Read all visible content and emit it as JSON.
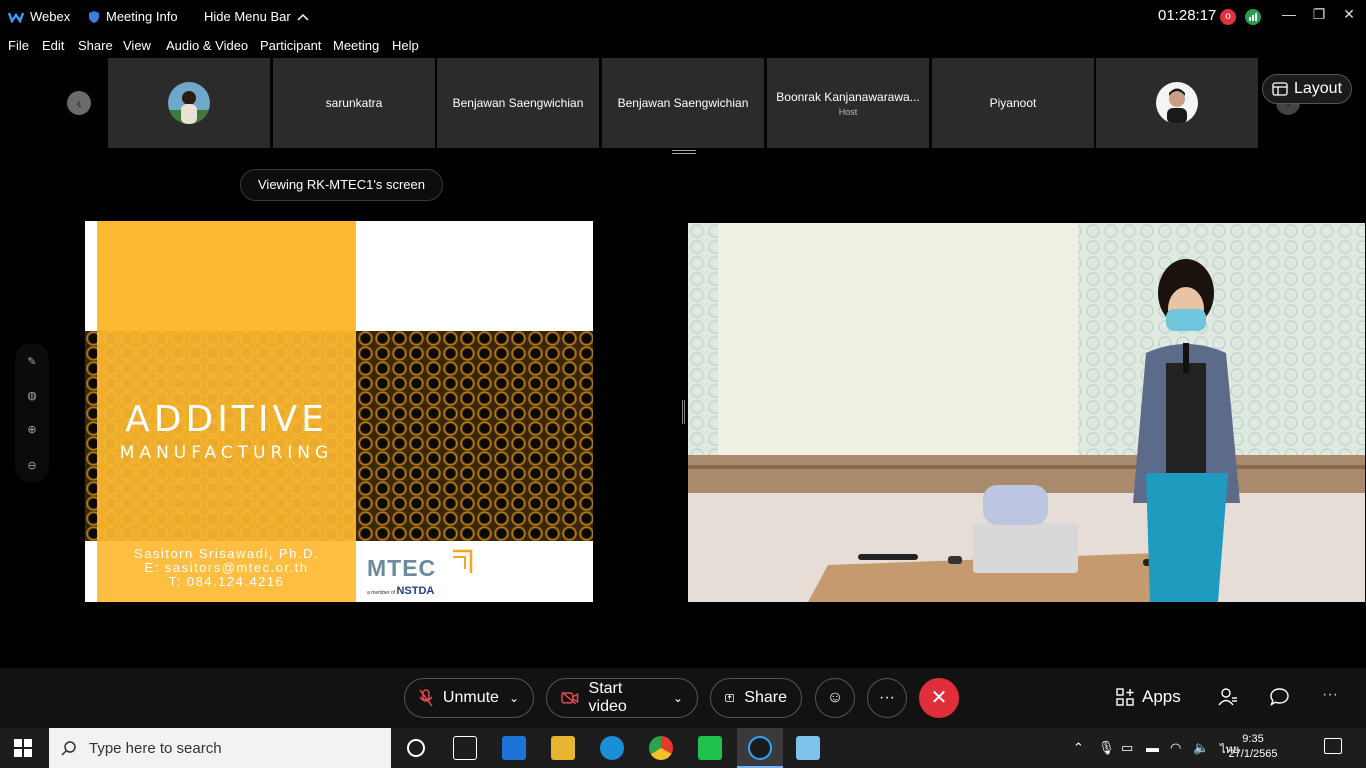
{
  "titlebar": {
    "app_name": "Webex",
    "meeting_info": "Meeting Info",
    "hide_menu": "Hide Menu Bar",
    "timer": "01:28:17",
    "rec_label": "o"
  },
  "menu": [
    "File",
    "Edit",
    "Share",
    "View",
    "Audio & Video",
    "Participant",
    "Meeting",
    "Help"
  ],
  "participants": [
    {
      "name": "",
      "sub": "",
      "avatar": true
    },
    {
      "name": "sarunkatra",
      "sub": ""
    },
    {
      "name": "Benjawan Saengwichian",
      "sub": ""
    },
    {
      "name": "Benjawan Saengwichian",
      "sub": ""
    },
    {
      "name": "Boonrak Kanjanawarawa...",
      "sub": "Host"
    },
    {
      "name": "Piyanoot",
      "sub": ""
    },
    {
      "name": "",
      "sub": "",
      "avatar": true
    }
  ],
  "layout_label": "Layout",
  "viewing_label": "Viewing RK-MTEC1's screen",
  "slide": {
    "title": "ADDITIVE",
    "subtitle": "MANUFACTURING",
    "contact_name": "Sasitorn Srisawadi, Ph.D.",
    "contact_email": "E: sasitors@mtec.or.th",
    "contact_phone": "T: 084.124.4216",
    "logo_text": "MTEC",
    "logo_member": "a member of",
    "logo_org": "NSTDA"
  },
  "controls": {
    "unmute": "Unmute",
    "start_video": "Start video",
    "share": "Share",
    "more": "···",
    "apps": "Apps",
    "overflow": "···"
  },
  "taskbar": {
    "search_placeholder": "Type here to search",
    "lang": "ไทย",
    "time": "9:35",
    "date": "27/1/2565"
  },
  "colors": {
    "end_button": "#e02f3a",
    "slide_orange": "#fdb931",
    "tile_bg": "#2b2b2b"
  }
}
